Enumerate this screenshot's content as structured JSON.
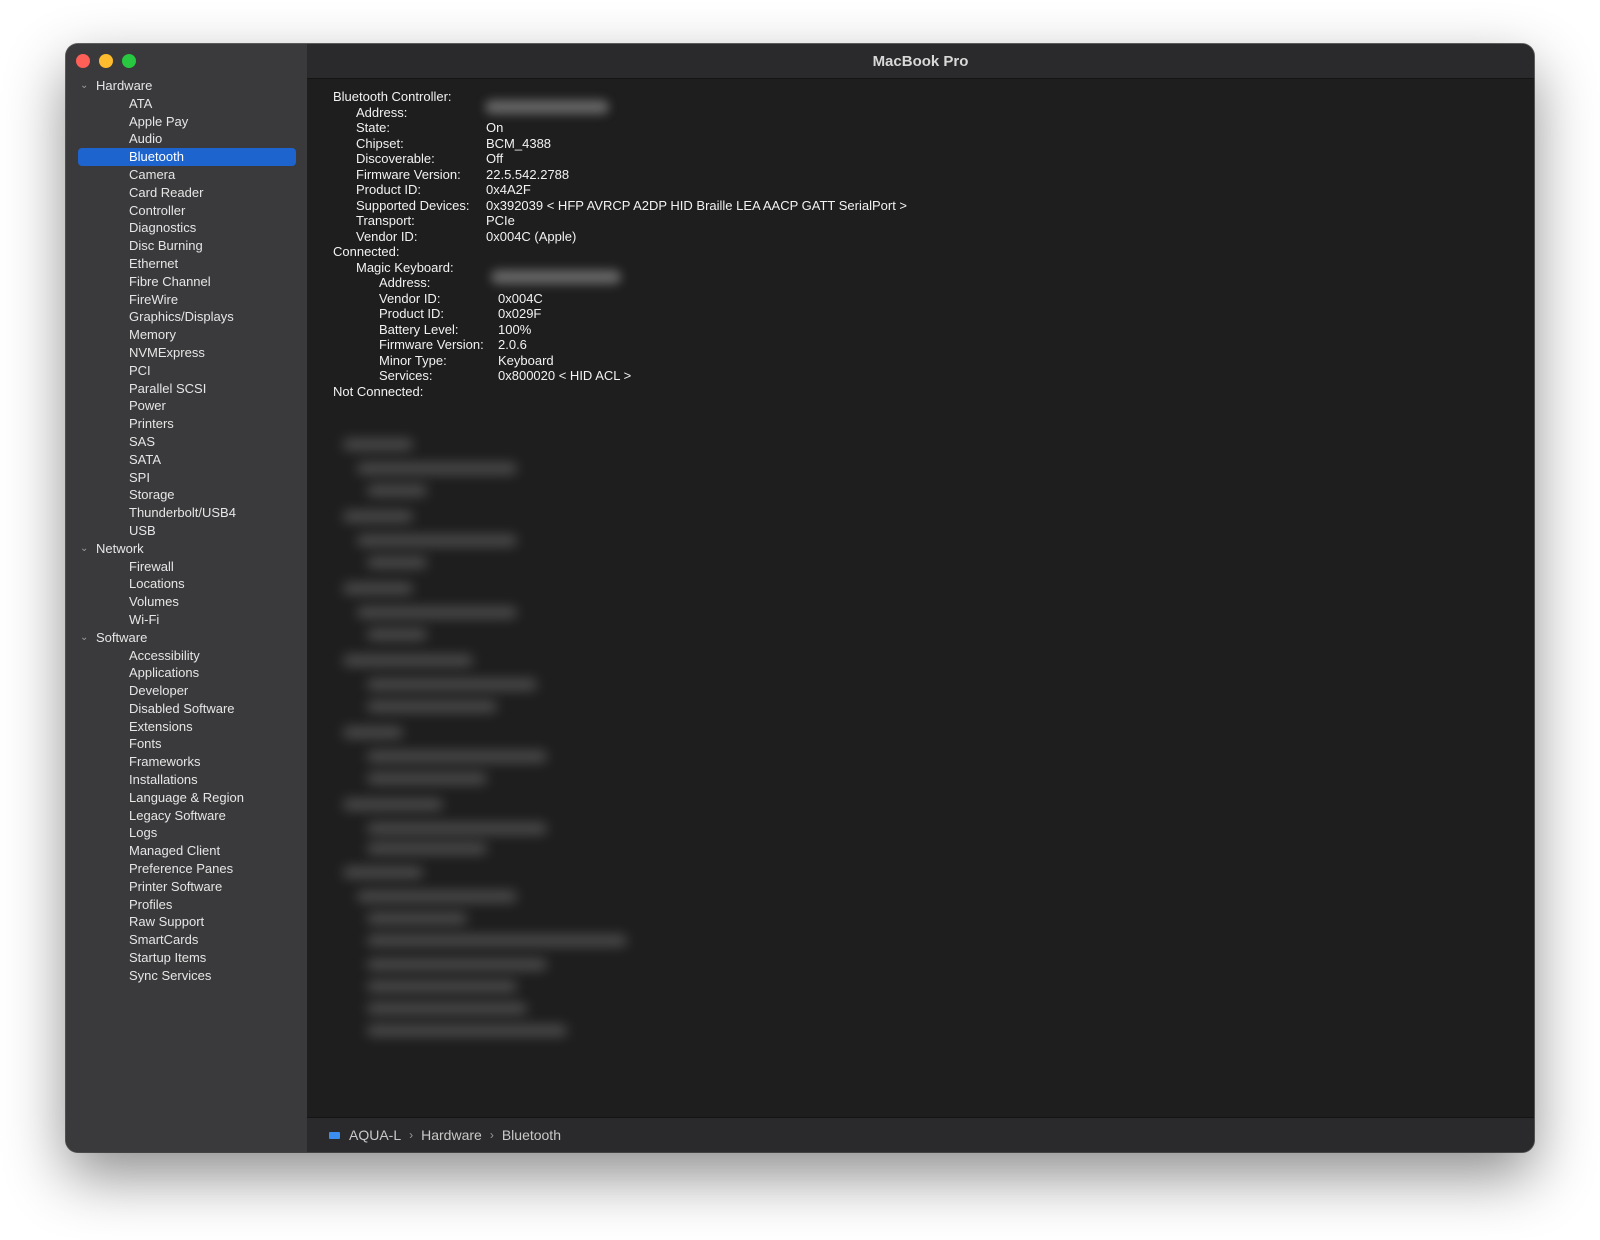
{
  "window": {
    "title": "MacBook Pro"
  },
  "sidebar": {
    "groups": [
      {
        "label": "Hardware",
        "items": [
          "ATA",
          "Apple Pay",
          "Audio",
          "Bluetooth",
          "Camera",
          "Card Reader",
          "Controller",
          "Diagnostics",
          "Disc Burning",
          "Ethernet",
          "Fibre Channel",
          "FireWire",
          "Graphics/Displays",
          "Memory",
          "NVMExpress",
          "PCI",
          "Parallel SCSI",
          "Power",
          "Printers",
          "SAS",
          "SATA",
          "SPI",
          "Storage",
          "Thunderbolt/USB4",
          "USB"
        ]
      },
      {
        "label": "Network",
        "items": [
          "Firewall",
          "Locations",
          "Volumes",
          "Wi-Fi"
        ]
      },
      {
        "label": "Software",
        "items": [
          "Accessibility",
          "Applications",
          "Developer",
          "Disabled Software",
          "Extensions",
          "Fonts",
          "Frameworks",
          "Installations",
          "Language & Region",
          "Legacy Software",
          "Logs",
          "Managed Client",
          "Preference Panes",
          "Printer Software",
          "Profiles",
          "Raw Support",
          "SmartCards",
          "Startup Items",
          "Sync Services"
        ]
      }
    ],
    "selected": "Bluetooth"
  },
  "info": {
    "controller_heading": "Bluetooth Controller:",
    "controller": {
      "address_label": "Address:",
      "state_label": "State:",
      "state": "On",
      "chipset_label": "Chipset:",
      "chipset": "BCM_4388",
      "discoverable_label": "Discoverable:",
      "discoverable": "Off",
      "firmware_label": "Firmware Version:",
      "firmware": "22.5.542.2788",
      "product_id_label": "Product ID:",
      "product_id": "0x4A2F",
      "supported_label": "Supported Devices:",
      "supported": "0x392039 < HFP AVRCP A2DP HID Braille LEA AACP GATT SerialPort >",
      "transport_label": "Transport:",
      "transport": "PCIe",
      "vendor_label": "Vendor ID:",
      "vendor": "0x004C (Apple)"
    },
    "connected_heading": "Connected:",
    "device": {
      "name": "Magic Keyboard:",
      "address_label": "Address:",
      "vendor_label": "Vendor ID:",
      "vendor": "0x004C",
      "product_label": "Product ID:",
      "product": "0x029F",
      "battery_label": "Battery Level:",
      "battery": "100%",
      "firmware_label": "Firmware Version:",
      "firmware": "2.0.6",
      "minor_label": "Minor Type:",
      "minor": "Keyboard",
      "services_label": "Services:",
      "services": "0x800020 < HID ACL >"
    },
    "not_connected_heading": "Not Connected:"
  },
  "status": {
    "crumbs": [
      "AQUA-L",
      "Hardware",
      "Bluetooth"
    ],
    "separator": "›"
  },
  "colors": {
    "selection": "#1d64cf",
    "sidebar": "#3a3a3c",
    "content": "#1e1e1e"
  }
}
